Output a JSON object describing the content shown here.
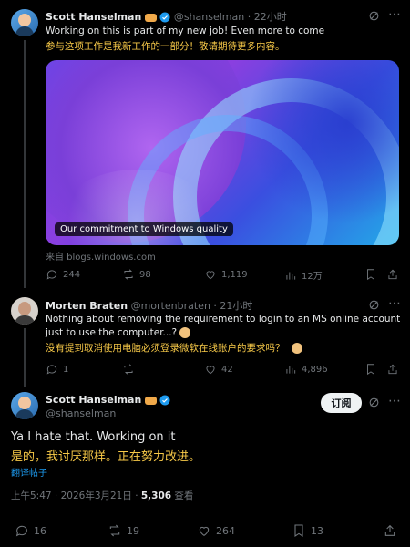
{
  "tweet1": {
    "name": "Scott Hanselman",
    "handle": "@shanselman",
    "time": "· 22小时",
    "text_en_l1": "Working on this is part of my new job! Even more to come",
    "text_zh": "参与这项工作是我新工作的一部分！敬请期待更多内容。",
    "card_caption": "Our commitment to Windows quality",
    "source": "来自 blogs.windows.com",
    "replies": "244",
    "retweets": "98",
    "likes": "1,119",
    "views": "12万"
  },
  "tweet2": {
    "name": "Morten Braten",
    "handle": "@mortenbraten",
    "time": "· 21小时",
    "text_en_l1": "Nothing about removing the requirement to login to an MS online account",
    "text_en_l2": "just to use the computer...?",
    "text_zh": "没有提到取消使用电脑必须登录微软在线账户的要求吗？",
    "replies": "1",
    "retweets": "",
    "likes": "42",
    "views": "4,896"
  },
  "tweet3": {
    "name": "Scott Hanselman",
    "handle": "@shanselman",
    "subscribe_label": "订阅",
    "text_en": "Ya I hate that. Working on it",
    "text_zh": "是的，我讨厌那样。正在努力改进。",
    "translate_label": "翻译帖子",
    "meta_time": "上午5:47 · 2026年3月21日 · ",
    "meta_views_num": "5,306",
    "meta_views_label": " 查看",
    "replies": "16",
    "retweets": "19",
    "likes": "264",
    "bookmarks": "13"
  },
  "colors": {
    "background": "#000000",
    "text": "#e7e9ea",
    "muted": "#71767b",
    "translation": "#f7c948",
    "verified": "#1d9bf0",
    "link": "#1d9bf0"
  }
}
